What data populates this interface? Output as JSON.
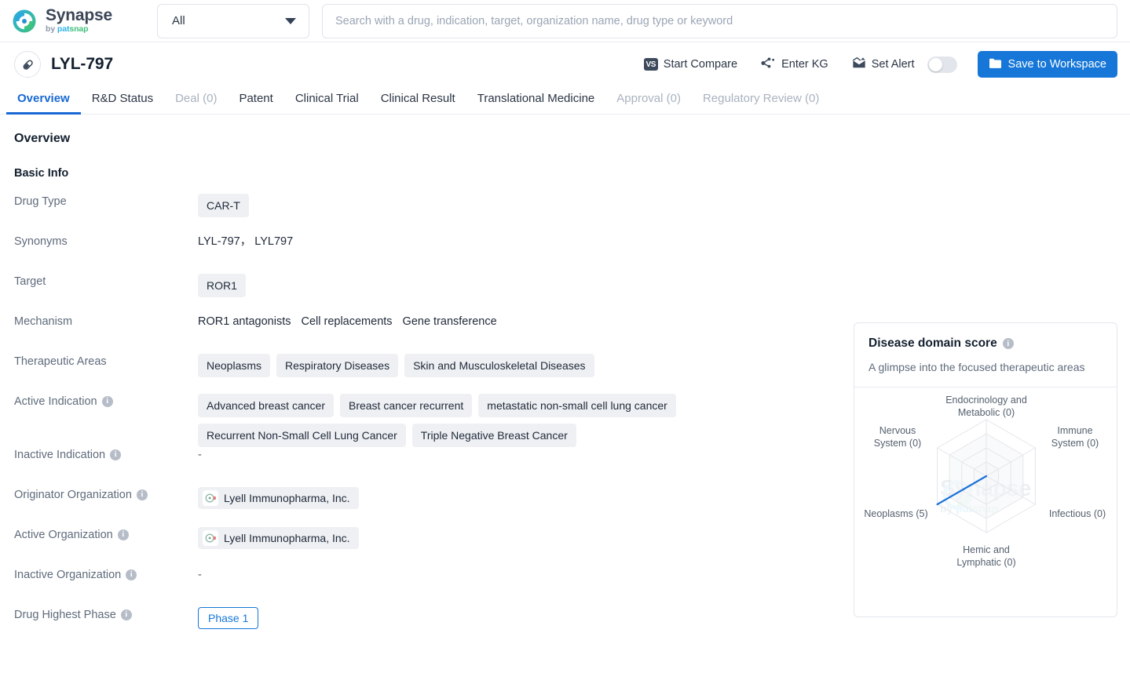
{
  "brand": {
    "name": "Synapse",
    "by": "by",
    "pat": "pat",
    "snap": "snap"
  },
  "search": {
    "scope_value": "All",
    "placeholder": "Search with a drug, indication, target, organization name, drug type or keyword"
  },
  "drug_header": {
    "title": "LYL-797",
    "start_compare": "Start Compare",
    "enter_kg": "Enter KG",
    "set_alert": "Set Alert",
    "save_to_workspace": "Save to Workspace",
    "accent_color": "#1677d8"
  },
  "tabs": [
    {
      "label": "Overview",
      "state": "active"
    },
    {
      "label": "R&D Status",
      "state": "normal"
    },
    {
      "label": "Deal (0)",
      "state": "dim"
    },
    {
      "label": "Patent",
      "state": "normal"
    },
    {
      "label": "Clinical Trial",
      "state": "normal"
    },
    {
      "label": "Clinical Result",
      "state": "normal"
    },
    {
      "label": "Translational Medicine",
      "state": "normal"
    },
    {
      "label": "Approval (0)",
      "state": "dim"
    },
    {
      "label": "Regulatory Review (0)",
      "state": "dim"
    }
  ],
  "page": {
    "overview_heading": "Overview",
    "basic_info_heading": "Basic Info"
  },
  "fields": {
    "drug_type": {
      "label": "Drug Type",
      "chips": [
        "CAR-T"
      ]
    },
    "synonyms": {
      "label": "Synonyms",
      "text": "LYL-797， LYL797"
    },
    "target": {
      "label": "Target",
      "chips": [
        "ROR1"
      ]
    },
    "mechanism": {
      "label": "Mechanism",
      "items": [
        "ROR1 antagonists",
        "Cell replacements",
        "Gene transference"
      ]
    },
    "therapeutic_areas": {
      "label": "Therapeutic Areas",
      "chips": [
        "Neoplasms",
        "Respiratory Diseases",
        "Skin and Musculoskeletal Diseases"
      ]
    },
    "active_indication": {
      "label": "Active Indication",
      "chips": [
        "Advanced breast cancer",
        "Breast cancer recurrent",
        "metastatic non-small cell lung cancer",
        "Recurrent Non-Small Cell Lung Cancer",
        "Triple Negative Breast Cancer"
      ]
    },
    "inactive_indication": {
      "label": "Inactive Indication",
      "value": "-"
    },
    "originator_organization": {
      "label": "Originator Organization",
      "chips": [
        "Lyell Immunopharma, Inc."
      ]
    },
    "active_organization": {
      "label": "Active Organization",
      "chips": [
        "Lyell Immunopharma, Inc."
      ]
    },
    "inactive_organization": {
      "label": "Inactive Organization",
      "value": "-"
    },
    "drug_highest_phase": {
      "label": "Drug Highest Phase",
      "value": "Phase 1"
    }
  },
  "score_panel": {
    "title": "Disease domain score",
    "subtitle": "A glimpse into the focused therapeutic areas"
  },
  "chart_data": {
    "type": "radar",
    "title": "Disease domain score",
    "subtitle": "A glimpse into the focused therapeutic areas",
    "categories": [
      "Endocrinology and Metabolic",
      "Immune System",
      "Infectious",
      "Hemic and Lymphatic",
      "Neoplasms",
      "Nervous System"
    ],
    "tick_labels": [
      "Endocrinology and\nMetabolic (0)",
      "Immune\nSystem (0)",
      "Infectious (0)",
      "Hemic and\nLymphatic (0)",
      "Neoplasms (5)",
      "Nervous\nSystem (0)"
    ],
    "values": [
      0,
      0,
      0,
      0,
      5,
      0
    ],
    "rmin": 0,
    "rmax": 5,
    "rings": 4,
    "grid": true,
    "legend": false,
    "series_color": "#1c71d8",
    "grid_color": "#e3e6ea",
    "watermark": "Synapse by patsnap"
  }
}
